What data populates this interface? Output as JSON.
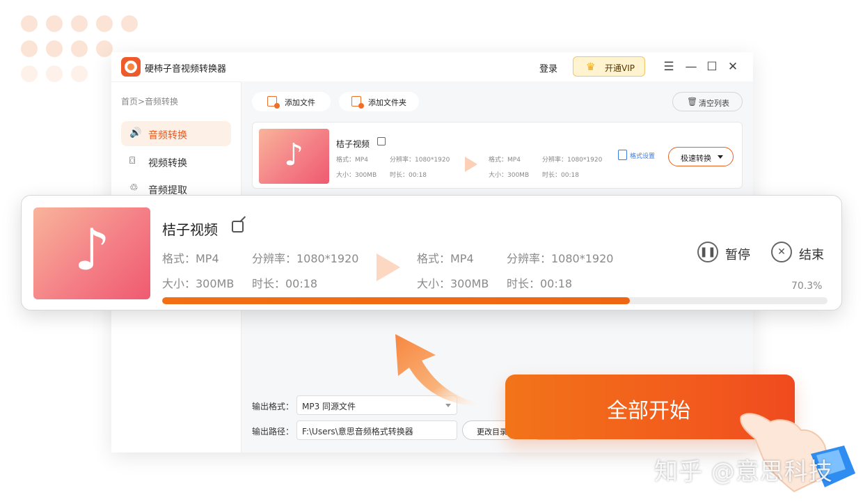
{
  "app": {
    "title": "硬柿子音视频转换器",
    "login_label": "登录",
    "vip_label": "开通VIP"
  },
  "sidebar": {
    "breadcrumb": "首页>音频转换",
    "items": [
      {
        "label": "音频转换",
        "icon": "speaker-icon",
        "active": true
      },
      {
        "label": "视频转换",
        "icon": "camera-icon",
        "active": false
      },
      {
        "label": "音频提取",
        "icon": "extract-icon",
        "active": false
      }
    ]
  },
  "toolbar": {
    "add_file_label": "添加文件",
    "add_folder_label": "添加文件夹",
    "clear_list_label": "清空列表"
  },
  "file_card": {
    "name": "桔子视频",
    "source": {
      "format": "格式：MP4",
      "resolution": "分辨率：1080*1920",
      "size": "大小：300MB",
      "duration": "时长：00:18"
    },
    "target": {
      "format": "格式：MP4",
      "resolution": "分辨率：1080*1920",
      "size": "大小：300MB",
      "duration": "时长：00:18"
    },
    "format_settings_label": "格式设置",
    "fast_convert_label": "极速转换"
  },
  "progress_card": {
    "name": "桔子视频",
    "source": {
      "format": "格式：MP4",
      "resolution": "分辨率：1080*1920",
      "size": "大小：300MB",
      "duration": "时长：00:18"
    },
    "target": {
      "format": "格式：MP4",
      "resolution": "分辨率：1080*1920",
      "size": "大小：300MB",
      "duration": "时长：00:18"
    },
    "pause_label": "暂停",
    "stop_label": "结束",
    "progress_text": "70.3%",
    "progress_value": 0.703
  },
  "output": {
    "format_label": "输出格式：",
    "format_value": "MP3  同源文件",
    "path_label": "输出路径：",
    "path_value": "F:\\Users\\意思音频格式转换器",
    "change_dir_label": "更改目录"
  },
  "start_all_label": "全部开始",
  "watermark": "知乎 @意思科技",
  "colors": {
    "accent": "#ee6e2a",
    "progress": "#f26f14",
    "link": "#3a7be3",
    "vip_bg": "#fff4cf"
  }
}
